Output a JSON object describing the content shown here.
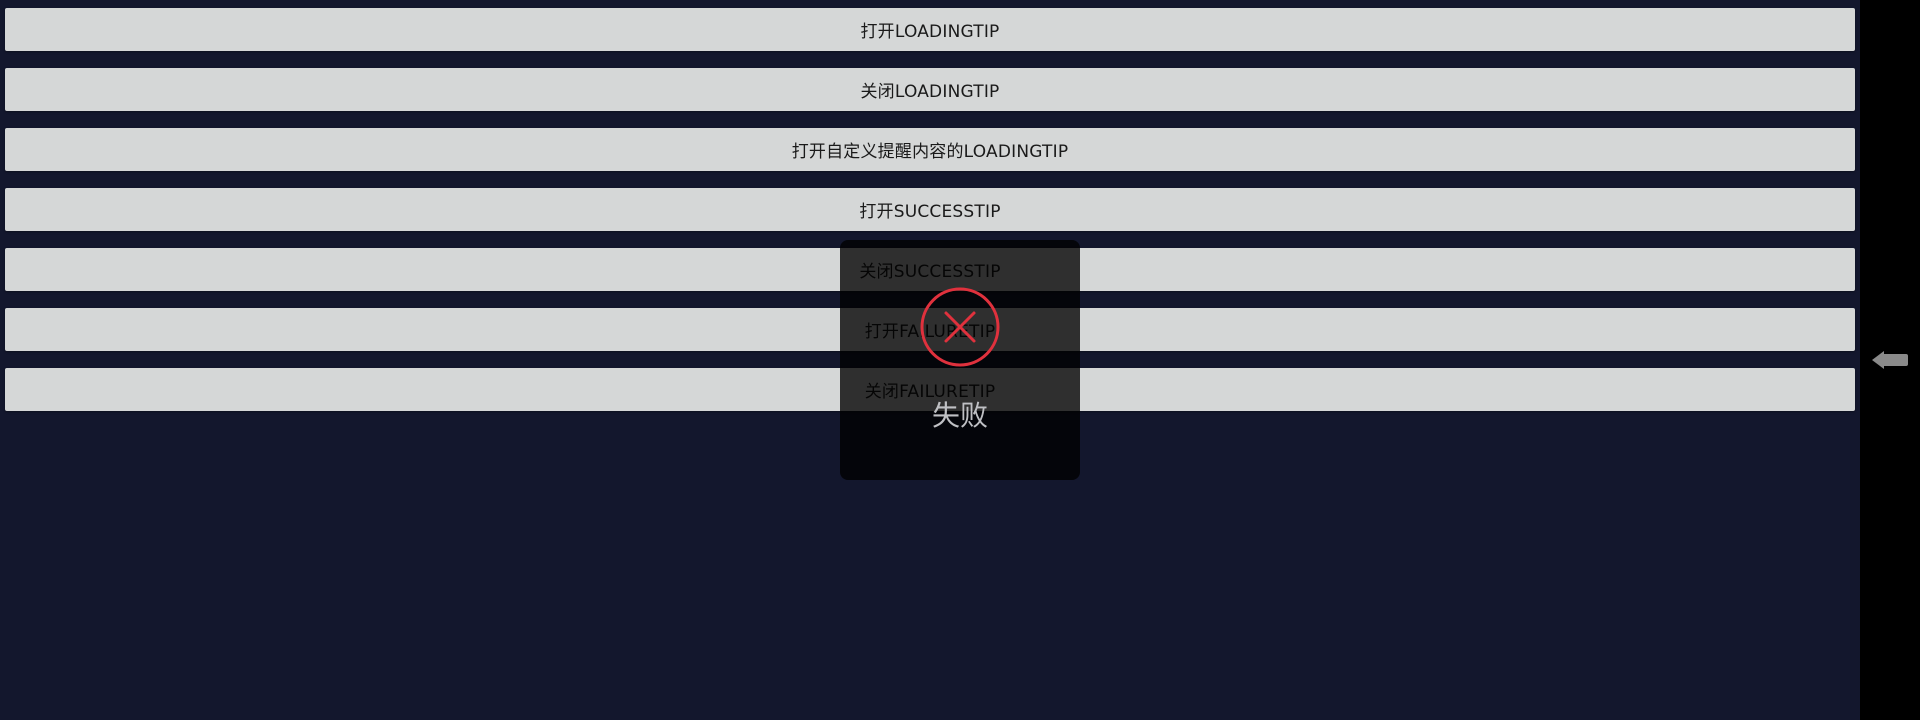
{
  "buttons": [
    {
      "label": "打开LOADINGTIP"
    },
    {
      "label": "关闭LOADINGTIP"
    },
    {
      "label": "打开自定义提醒内容的LOADINGTIP"
    },
    {
      "label": "打开SUCCESSTIP"
    },
    {
      "label": "关闭SUCCESSTIP"
    },
    {
      "label": "打开FAILURETIP"
    },
    {
      "label": "关闭FAILURETIP"
    }
  ],
  "toast": {
    "text": "失败",
    "icon": "close-circle-icon",
    "icon_color": "#e0313d"
  },
  "nav": {
    "back_icon": "back-arrow-icon"
  },
  "colors": {
    "background": "#13172d",
    "button": "#d5d7d7",
    "nav_bar": "#000000"
  }
}
